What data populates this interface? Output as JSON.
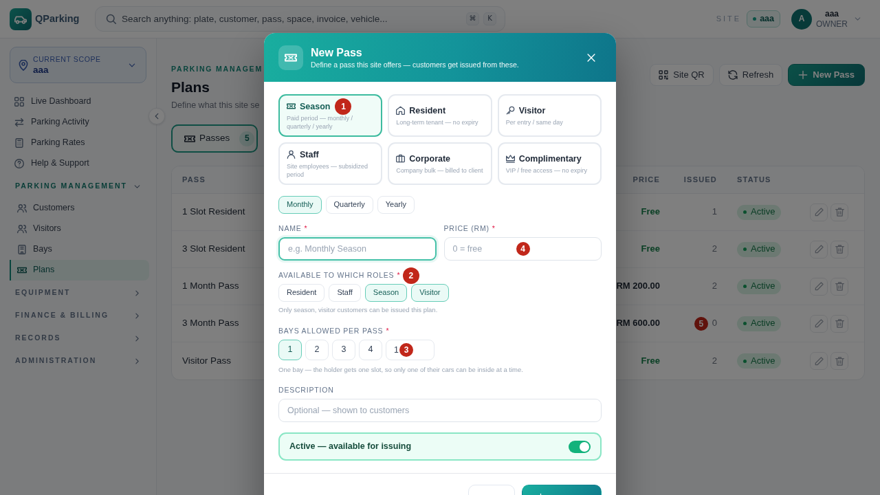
{
  "topbar": {
    "brand": "QParking",
    "search": {
      "placeholder": "Search anything: plate, customer, pass, space, invoice, vehicle...",
      "keys": [
        "⌘",
        "K"
      ]
    },
    "site_label": "SITE",
    "site": "aaa",
    "user": {
      "initial": "A",
      "name": "aaa",
      "role": "OWNER"
    }
  },
  "sidebar": {
    "scope": {
      "label": "CURRENT SCOPE",
      "value": "aaa"
    },
    "items": [
      {
        "label": "Live Dashboard",
        "selected": false
      },
      {
        "label": "Parking Activity",
        "selected": false
      },
      {
        "label": "Parking Rates",
        "selected": false
      },
      {
        "label": "Help & Support",
        "selected": false
      }
    ],
    "sections": [
      {
        "title": "PARKING MANAGEMENT",
        "expanded": true,
        "items": [
          {
            "label": "Customers",
            "selected": false
          },
          {
            "label": "Visitors",
            "selected": false
          },
          {
            "label": "Bays",
            "selected": false
          },
          {
            "label": "Plans",
            "selected": true
          }
        ]
      },
      {
        "title": "EQUIPMENT",
        "expanded": false
      },
      {
        "title": "FINANCE & BILLING",
        "expanded": false
      },
      {
        "title": "RECORDS",
        "expanded": false
      },
      {
        "title": "ADMINISTRATION",
        "expanded": false
      }
    ]
  },
  "page": {
    "eyebrow": "PARKING MANAGEM",
    "title": "Plans",
    "subtitle": "Define what this site se",
    "actions": [
      {
        "label": "Site QR",
        "kind": "secondary"
      },
      {
        "label": "Refresh",
        "kind": "secondary"
      },
      {
        "label": "New Pass",
        "kind": "primary"
      }
    ],
    "tabs": [
      {
        "label": "Passes",
        "count": "5",
        "selected": true
      }
    ]
  },
  "table": {
    "columns": [
      "PASS",
      "PRICE",
      "ISSUED",
      "STATUS"
    ],
    "rows": [
      {
        "pass": "1 Slot Resident",
        "price": "Free",
        "free": true,
        "issued": "1",
        "status": "Active",
        "active": true
      },
      {
        "pass": "3 Slot Resident",
        "price": "Free",
        "free": true,
        "issued": "2",
        "status": "Active",
        "active": true
      },
      {
        "pass": "1 Month Pass",
        "price": "RM 200.00",
        "free": false,
        "issued": "2",
        "status": "Active",
        "active": true
      },
      {
        "pass": "3 Month Pass",
        "price": "RM 600.00",
        "free": false,
        "issued": "0",
        "status": "Active",
        "active": true,
        "marker": "5"
      },
      {
        "pass": "Visitor Pass",
        "price": "Free",
        "free": true,
        "issued": "2",
        "status": "Active",
        "active": true
      }
    ]
  },
  "modal": {
    "title": "New Pass",
    "subtitle": "Define a pass this site offers — customers get issued from these.",
    "types": [
      {
        "title": "Season",
        "description": "Paid period — monthly / quarterly / yearly",
        "selected": true,
        "marker": "1"
      },
      {
        "title": "Resident",
        "description": "Long-term tenant — no expiry",
        "selected": false
      },
      {
        "title": "Visitor",
        "description": "Per entry / same day",
        "selected": false
      },
      {
        "title": "Staff",
        "description": "Site employees — subsidized period",
        "selected": false
      },
      {
        "title": "Corporate",
        "description": "Company bulk — billed to client",
        "selected": false
      },
      {
        "title": "Complimentary",
        "description": "VIP / free access — no expiry",
        "selected": false
      }
    ],
    "periods": [
      {
        "label": "Monthly",
        "selected": true
      },
      {
        "label": "Quarterly",
        "selected": false
      },
      {
        "label": "Yearly",
        "selected": false
      }
    ],
    "name": {
      "label": "NAME",
      "asterisk": "*",
      "placeholder": "e.g. Monthly Season",
      "focused": true
    },
    "price": {
      "label": "PRICE (RM)",
      "asterisk": "*",
      "placeholder": "0 = free",
      "marker": "4"
    },
    "roles": {
      "label": "AVAILABLE TO WHICH ROLES",
      "asterisk": "*",
      "marker": "2",
      "options": [
        {
          "label": "Resident",
          "selected": false
        },
        {
          "label": "Staff",
          "selected": false
        },
        {
          "label": "Season",
          "selected": true
        },
        {
          "label": "Visitor",
          "selected": true
        }
      ],
      "hint": "Only season, visitor customers can be issued this plan."
    },
    "bays": {
      "label": "BAYS ALLOWED PER PASS",
      "asterisk": "*",
      "options": [
        {
          "label": "1",
          "selected": true
        },
        {
          "label": "2",
          "selected": false
        },
        {
          "label": "3",
          "selected": false
        },
        {
          "label": "4",
          "selected": false
        }
      ],
      "custom": {
        "value": "1",
        "marker": "3"
      },
      "hint": "One bay — the holder gets one slot, so only one of their cars can be inside at a time."
    },
    "description": {
      "label": "DESCRIPTION",
      "placeholder": "Optional — shown to customers"
    },
    "active": {
      "label": "Active — available for issuing",
      "on": true
    },
    "buttons": [
      {
        "kind": "secondary"
      },
      {
        "kind": "primary"
      }
    ]
  }
}
